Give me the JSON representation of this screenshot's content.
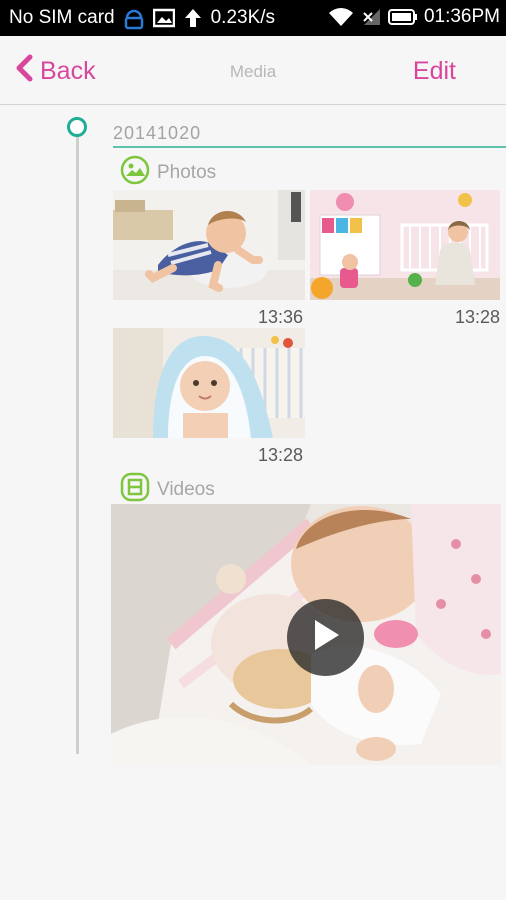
{
  "status_bar": {
    "carrier": "No SIM card",
    "speed": "0.23K/s",
    "time": "01:36PM"
  },
  "nav": {
    "back_label": "Back",
    "title": "Media",
    "edit_label": "Edit"
  },
  "timeline": {
    "date": "20141020",
    "photos_label": "Photos",
    "videos_label": "Videos",
    "photos": [
      {
        "time": "13:36"
      },
      {
        "time": "13:28"
      },
      {
        "time": "13:28"
      }
    ]
  },
  "colors": {
    "accent": "#d8479c",
    "timeline_green": "#1fae95",
    "section_icon_green": "#7dc63d"
  }
}
